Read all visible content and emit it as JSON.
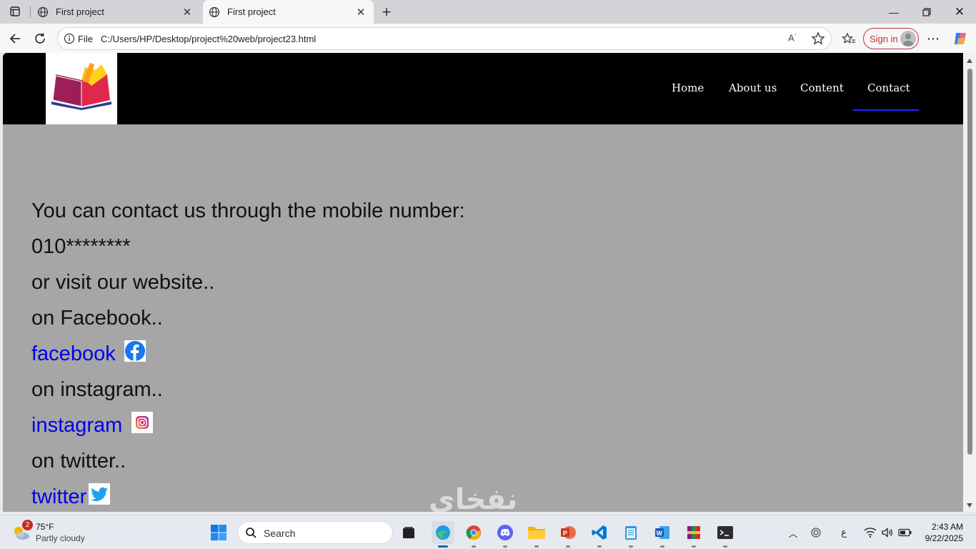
{
  "browser": {
    "tabs": [
      {
        "title": "First project",
        "active": false
      },
      {
        "title": "First project",
        "active": true
      }
    ],
    "address": {
      "scheme_label": "File",
      "url": "C:/Users/HP/Desktop/project%20web/project23.html"
    },
    "signin_label": "Sign in"
  },
  "site": {
    "nav": [
      {
        "label": "Home"
      },
      {
        "label": "About us"
      },
      {
        "label": "Content"
      },
      {
        "label": "Contact"
      }
    ],
    "active_nav": "Contact",
    "colors": {
      "header_bg": "#000000",
      "page_bg": "#a6a6a6",
      "link": "#0000ee",
      "active_underline": "#2424ff"
    }
  },
  "contact": {
    "intro": "You can contact us through the mobile number:",
    "phone": "010********",
    "website_prompt": "or visit our website..",
    "facebook_prompt": "on Facebook..",
    "facebook_link": "facebook",
    "instagram_prompt": "on instagram..",
    "instagram_link": "instagram",
    "twitter_prompt": "on twitter..",
    "twitter_link": "twitter"
  },
  "watermark": "نفخاي",
  "taskbar": {
    "weather": {
      "badge": "2",
      "temp": "75°F",
      "condition": "Partly cloudy"
    },
    "search_label": "Search",
    "language": "ع",
    "time": "2:43 AM",
    "date": "9/22/2025"
  }
}
